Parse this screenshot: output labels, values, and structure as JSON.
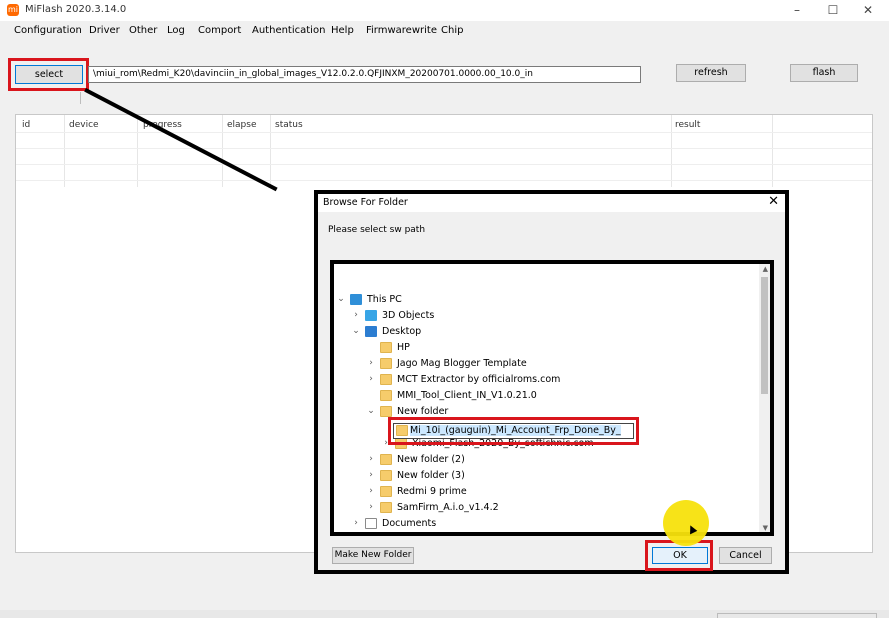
{
  "window": {
    "title": "MiFlash 2020.3.14.0",
    "icon_name": "miflash-app-icon"
  },
  "menu": [
    "Configuration",
    "Driver",
    "Other",
    "Log",
    "Comport",
    "Authentication",
    "Help",
    "Firmwarewrite",
    "Chip"
  ],
  "toolbar": {
    "select_label": "select",
    "path_value": "\\miui_rom\\Redmi_K20\\davinciin_in_global_images_V12.0.2.0.QFJINXM_20200701.0000.00_10.0_in",
    "refresh_label": "refresh",
    "flash_label": "flash"
  },
  "table": {
    "columns": [
      "id",
      "device",
      "progress",
      "elapse",
      "status",
      "result"
    ]
  },
  "dialog": {
    "title": "Browse For Folder",
    "prompt": "Please select sw path",
    "tree": [
      {
        "label": "This PC",
        "icon": "pc-icon",
        "chevron": "down"
      },
      {
        "label": "3D Objects",
        "icon": "3d-objects-icon",
        "chevron": "right"
      },
      {
        "label": "Desktop",
        "icon": "desktop-icon",
        "chevron": "down"
      },
      {
        "label": "HP",
        "icon": "folder-icon",
        "chevron": ""
      },
      {
        "label": "Jago Mag Blogger Template",
        "icon": "folder-icon",
        "chevron": "right"
      },
      {
        "label": "MCT Extractor by officialroms.com",
        "icon": "folder-icon",
        "chevron": "right"
      },
      {
        "label": "MMI_Tool_Client_IN_V1.0.21.0",
        "icon": "folder-icon",
        "chevron": ""
      },
      {
        "label": "New folder",
        "icon": "folder-icon",
        "chevron": "down"
      },
      {
        "label": "Mi_10i_(gauguin)_Mi_Account_Frp_Done_By_",
        "icon": "folder-icon",
        "chevron": "",
        "selected": true
      },
      {
        "label": "Xiaomi_Flash_2020_By_softichnic.com",
        "icon": "folder-icon",
        "chevron": "right"
      },
      {
        "label": "New folder (2)",
        "icon": "folder-icon",
        "chevron": "right"
      },
      {
        "label": "New folder (3)",
        "icon": "folder-icon",
        "chevron": "right"
      },
      {
        "label": "Redmi 9 prime",
        "icon": "folder-icon",
        "chevron": "right"
      },
      {
        "label": "SamFirm_A.i.o_v1.4.2",
        "icon": "folder-icon",
        "chevron": "right"
      },
      {
        "label": "Documents",
        "icon": "documents-icon",
        "chevron": "right"
      }
    ],
    "make_new_folder_label": "Make New Folder",
    "ok_label": "OK",
    "cancel_label": "Cancel"
  },
  "colors": {
    "highlight_red": "#d9151c",
    "cursor_yellow": "#f7e10c",
    "selection_blue": "#cce8ff"
  }
}
